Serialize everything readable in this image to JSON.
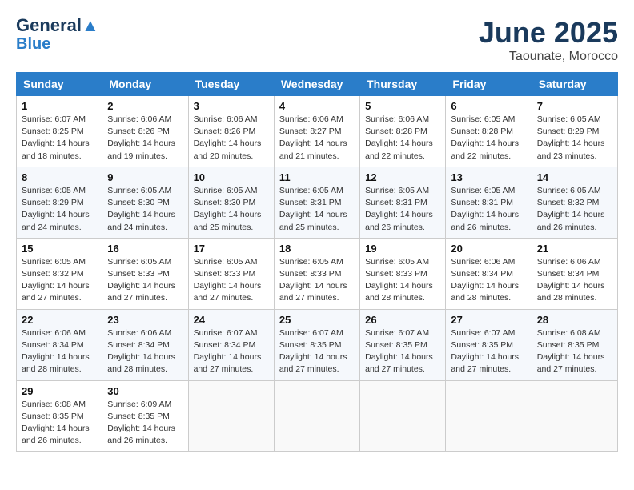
{
  "logo": {
    "line1": "General",
    "line2": "Blue"
  },
  "title": "June 2025",
  "subtitle": "Taounate, Morocco",
  "days_of_week": [
    "Sunday",
    "Monday",
    "Tuesday",
    "Wednesday",
    "Thursday",
    "Friday",
    "Saturday"
  ],
  "weeks": [
    [
      {
        "day": "1",
        "info": "Sunrise: 6:07 AM\nSunset: 8:25 PM\nDaylight: 14 hours\nand 18 minutes."
      },
      {
        "day": "2",
        "info": "Sunrise: 6:06 AM\nSunset: 8:26 PM\nDaylight: 14 hours\nand 19 minutes."
      },
      {
        "day": "3",
        "info": "Sunrise: 6:06 AM\nSunset: 8:26 PM\nDaylight: 14 hours\nand 20 minutes."
      },
      {
        "day": "4",
        "info": "Sunrise: 6:06 AM\nSunset: 8:27 PM\nDaylight: 14 hours\nand 21 minutes."
      },
      {
        "day": "5",
        "info": "Sunrise: 6:06 AM\nSunset: 8:28 PM\nDaylight: 14 hours\nand 22 minutes."
      },
      {
        "day": "6",
        "info": "Sunrise: 6:05 AM\nSunset: 8:28 PM\nDaylight: 14 hours\nand 22 minutes."
      },
      {
        "day": "7",
        "info": "Sunrise: 6:05 AM\nSunset: 8:29 PM\nDaylight: 14 hours\nand 23 minutes."
      }
    ],
    [
      {
        "day": "8",
        "info": "Sunrise: 6:05 AM\nSunset: 8:29 PM\nDaylight: 14 hours\nand 24 minutes."
      },
      {
        "day": "9",
        "info": "Sunrise: 6:05 AM\nSunset: 8:30 PM\nDaylight: 14 hours\nand 24 minutes."
      },
      {
        "day": "10",
        "info": "Sunrise: 6:05 AM\nSunset: 8:30 PM\nDaylight: 14 hours\nand 25 minutes."
      },
      {
        "day": "11",
        "info": "Sunrise: 6:05 AM\nSunset: 8:31 PM\nDaylight: 14 hours\nand 25 minutes."
      },
      {
        "day": "12",
        "info": "Sunrise: 6:05 AM\nSunset: 8:31 PM\nDaylight: 14 hours\nand 26 minutes."
      },
      {
        "day": "13",
        "info": "Sunrise: 6:05 AM\nSunset: 8:31 PM\nDaylight: 14 hours\nand 26 minutes."
      },
      {
        "day": "14",
        "info": "Sunrise: 6:05 AM\nSunset: 8:32 PM\nDaylight: 14 hours\nand 26 minutes."
      }
    ],
    [
      {
        "day": "15",
        "info": "Sunrise: 6:05 AM\nSunset: 8:32 PM\nDaylight: 14 hours\nand 27 minutes."
      },
      {
        "day": "16",
        "info": "Sunrise: 6:05 AM\nSunset: 8:33 PM\nDaylight: 14 hours\nand 27 minutes."
      },
      {
        "day": "17",
        "info": "Sunrise: 6:05 AM\nSunset: 8:33 PM\nDaylight: 14 hours\nand 27 minutes."
      },
      {
        "day": "18",
        "info": "Sunrise: 6:05 AM\nSunset: 8:33 PM\nDaylight: 14 hours\nand 27 minutes."
      },
      {
        "day": "19",
        "info": "Sunrise: 6:05 AM\nSunset: 8:33 PM\nDaylight: 14 hours\nand 28 minutes."
      },
      {
        "day": "20",
        "info": "Sunrise: 6:06 AM\nSunset: 8:34 PM\nDaylight: 14 hours\nand 28 minutes."
      },
      {
        "day": "21",
        "info": "Sunrise: 6:06 AM\nSunset: 8:34 PM\nDaylight: 14 hours\nand 28 minutes."
      }
    ],
    [
      {
        "day": "22",
        "info": "Sunrise: 6:06 AM\nSunset: 8:34 PM\nDaylight: 14 hours\nand 28 minutes."
      },
      {
        "day": "23",
        "info": "Sunrise: 6:06 AM\nSunset: 8:34 PM\nDaylight: 14 hours\nand 28 minutes."
      },
      {
        "day": "24",
        "info": "Sunrise: 6:07 AM\nSunset: 8:34 PM\nDaylight: 14 hours\nand 27 minutes."
      },
      {
        "day": "25",
        "info": "Sunrise: 6:07 AM\nSunset: 8:35 PM\nDaylight: 14 hours\nand 27 minutes."
      },
      {
        "day": "26",
        "info": "Sunrise: 6:07 AM\nSunset: 8:35 PM\nDaylight: 14 hours\nand 27 minutes."
      },
      {
        "day": "27",
        "info": "Sunrise: 6:07 AM\nSunset: 8:35 PM\nDaylight: 14 hours\nand 27 minutes."
      },
      {
        "day": "28",
        "info": "Sunrise: 6:08 AM\nSunset: 8:35 PM\nDaylight: 14 hours\nand 27 minutes."
      }
    ],
    [
      {
        "day": "29",
        "info": "Sunrise: 6:08 AM\nSunset: 8:35 PM\nDaylight: 14 hours\nand 26 minutes."
      },
      {
        "day": "30",
        "info": "Sunrise: 6:09 AM\nSunset: 8:35 PM\nDaylight: 14 hours\nand 26 minutes."
      },
      null,
      null,
      null,
      null,
      null
    ]
  ]
}
